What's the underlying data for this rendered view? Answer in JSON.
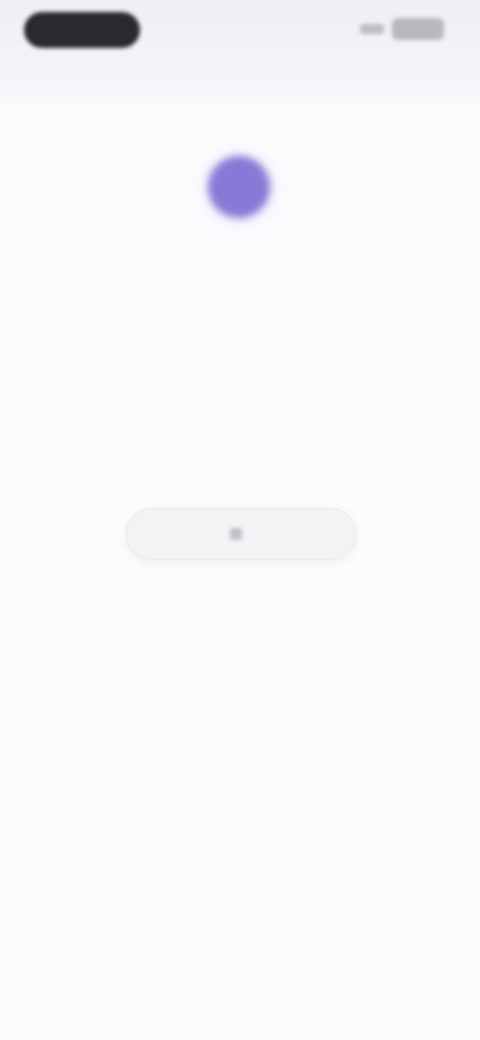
{
  "status_bar": {
    "time": "",
    "network": "",
    "battery": ""
  },
  "header": {
    "title": ""
  },
  "profile": {
    "avatar_color": "#8a78d6",
    "caption_top": "",
    "value": "",
    "caption_bottom": ""
  },
  "actions": {
    "primary_label": "",
    "primary_icon": "unknown-icon"
  }
}
